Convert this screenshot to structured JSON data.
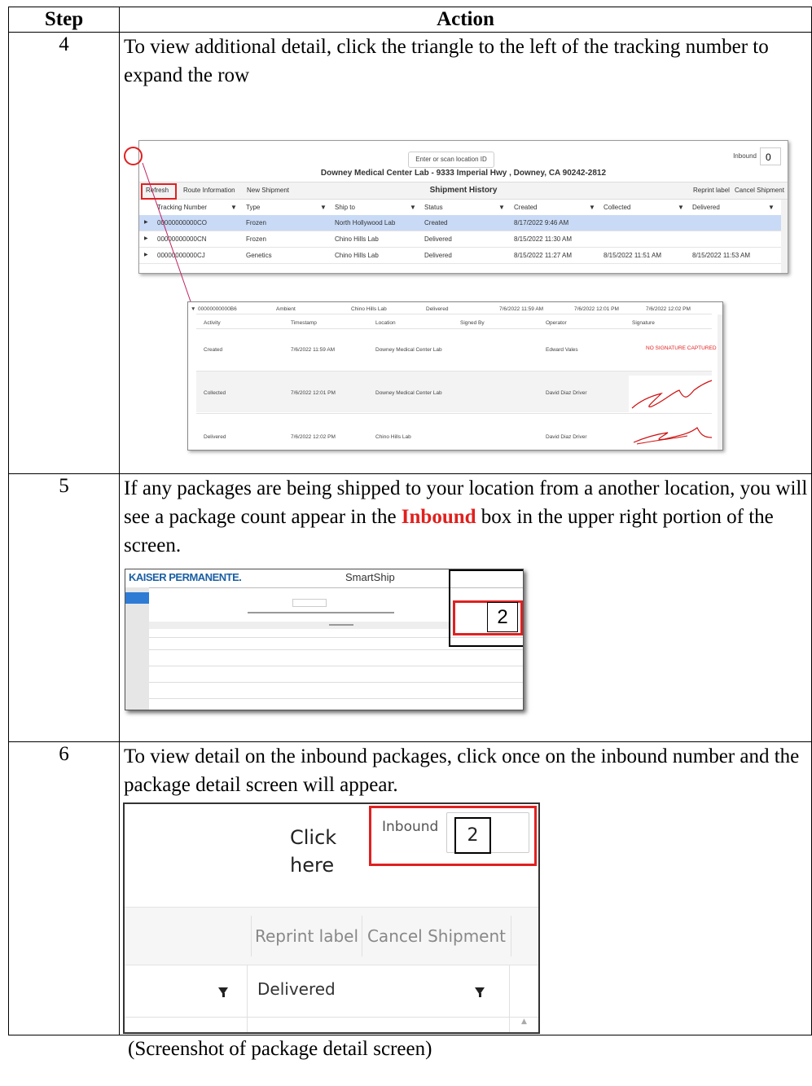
{
  "table": {
    "header_step": "Step",
    "header_action": "Action"
  },
  "rows": [
    {
      "step": "4",
      "text": "To view additional detail, click the triangle to the left of the tracking number to expand the row"
    },
    {
      "step": "5",
      "text_before": "If any packages are being shipped to your location from a another location, you will see a package count appear in the ",
      "text_highlight": "Inbound",
      "text_after": " box in the upper right portion of the screen."
    },
    {
      "step": "6",
      "text": "To view detail on the inbound packages, click once on the inbound number and the package detail screen will appear.",
      "caption": "(Screenshot of package detail screen)"
    }
  ],
  "shot1": {
    "location_placeholder": "Enter or scan location ID",
    "inbound_label": "Inbound",
    "inbound_value": "0",
    "address": "Downey Medical Center Lab - 9333 Imperial Hwy , Downey, CA 90242-2812",
    "buttons": {
      "refresh": "Refresh",
      "route": "Route Information",
      "new": "New Shipment",
      "reprint": "Reprint label",
      "cancel": "Cancel Shipment"
    },
    "history_title": "Shipment History",
    "columns": [
      "Tracking Number",
      "Type",
      "Ship to",
      "Status",
      "Created",
      "Collected",
      "Delivered"
    ],
    "rows": [
      [
        "00000000000CO",
        "Frozen",
        "North Hollywood Lab",
        "Created",
        "8/17/2022 9:46 AM",
        "",
        ""
      ],
      [
        "00000000000CN",
        "Frozen",
        "Chino Hills Lab",
        "Delivered",
        "8/15/2022 11:30 AM",
        "",
        ""
      ],
      [
        "00000000000CJ",
        "Genetics",
        "Chino Hills Lab",
        "Delivered",
        "8/15/2022 11:27 AM",
        "8/15/2022 11:51 AM",
        "8/15/2022 11:53 AM"
      ]
    ]
  },
  "shot1b": {
    "summary": [
      "00000000000B6",
      "Ambient",
      "Chino Hills Lab",
      "Delivered",
      "7/6/2022 11:59 AM",
      "7/6/2022 12:01 PM",
      "7/6/2022 12:02 PM"
    ],
    "columns": [
      "Activity",
      "Timestamp",
      "Location",
      "Signed By",
      "Operator",
      "Signature"
    ],
    "rows": [
      [
        "Created",
        "7/6/2022 11:59 AM",
        "Downey Medical Center Lab",
        "",
        "Edward Vales",
        "NO SIGNATURE CAPTURED"
      ],
      [
        "Collected",
        "7/6/2022 12:01 PM",
        "Downey Medical Center Lab",
        "",
        "David Diaz Driver",
        ""
      ],
      [
        "Delivered",
        "7/6/2022 12:02 PM",
        "Chino Hills Lab",
        "",
        "David Diaz Driver",
        ""
      ]
    ]
  },
  "shot2": {
    "logo": "KAISER PERMANENTE.",
    "app": "SmartShip",
    "inbound_value": "2"
  },
  "shot3": {
    "click_here": "Click here",
    "inbound_label": "Inbound",
    "inbound_value": "2",
    "reprint": "Reprint label",
    "cancel": "Cancel Shipment",
    "delivered": "Delivered"
  },
  "colors": {
    "highlight_red": "#e0201d",
    "selected_row": "#c9daf6"
  }
}
